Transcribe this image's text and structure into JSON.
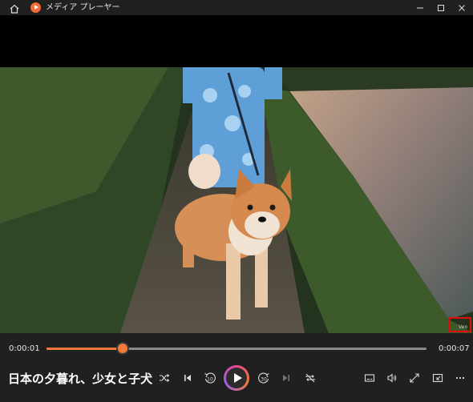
{
  "window": {
    "title": "メディア プレーヤー",
    "icons": [
      "home-icon",
      "media-player-app-icon",
      "minimize-icon",
      "maximize-icon",
      "close-icon"
    ]
  },
  "video": {
    "description_icons": [
      "video-frame"
    ],
    "watermark": "Veo"
  },
  "playback": {
    "current_time": "0:00:01",
    "total_time": "0:00:07",
    "progress_fraction": 0.2
  },
  "media": {
    "title": "日本の夕暮れ、少女と子犬"
  },
  "controls": {
    "left": [
      "shuffle-icon",
      "previous-icon",
      "rewind-10-icon",
      "play-icon",
      "forward-30-icon",
      "next-icon",
      "repeat-off-icon"
    ],
    "right": [
      "subtitles-icon",
      "volume-icon",
      "fullscreen-icon",
      "miniplayer-icon",
      "more-icon"
    ]
  },
  "colors": {
    "accent": "#f47a3a",
    "highlight": "#e30d0d",
    "background": "#202020"
  }
}
